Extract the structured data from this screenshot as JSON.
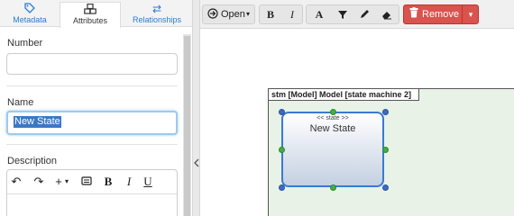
{
  "left_panel": {
    "tabs": [
      {
        "label": "Metadata",
        "icon": "tag-icon"
      },
      {
        "label": "Attributes",
        "icon": "cubes-icon"
      },
      {
        "label": "Relationships",
        "icon": "swap-icon"
      }
    ],
    "number": {
      "label": "Number",
      "value": ""
    },
    "name": {
      "label": "Name",
      "value": "New State"
    },
    "description": {
      "label": "Description"
    },
    "editor_toolbar": {
      "undo": "↶",
      "redo": "↷",
      "insert": "+",
      "insert_caret": "▾",
      "bold": "B",
      "italic": "I",
      "underline": "U"
    }
  },
  "toolbar": {
    "open_label": "Open",
    "remove_label": "Remove"
  },
  "diagram": {
    "title": "stm [Model] Model [state machine 2]",
    "state": {
      "stereotype": "<< state >>",
      "name": "New State"
    }
  },
  "colors": {
    "accent": "#2a7bd1",
    "remove": "#d9534f",
    "selection": "#3b78c4",
    "diagram_bg": "#e8f2e6"
  }
}
